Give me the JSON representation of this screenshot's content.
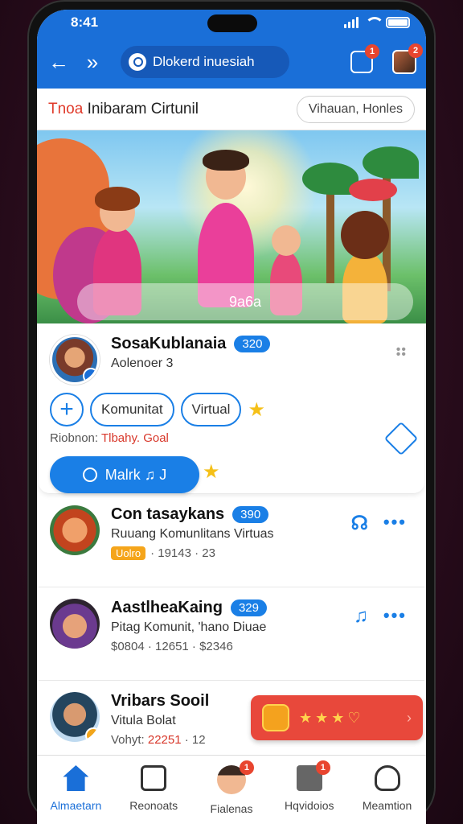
{
  "status": {
    "time": "8:41"
  },
  "nav": {
    "back_icon": "arrow-left-icon",
    "forward_icon": "chevron-right-icon",
    "search_placeholder": "Dlokerd inuesiah",
    "notify_badge": "1",
    "avatar_badge": "2"
  },
  "subheader": {
    "title_red": "Tnoa",
    "title_rest": " Inibaram Cirtunil",
    "pill": "Vihauan, Honles"
  },
  "hero": {
    "caption": "9a6a"
  },
  "featured": {
    "name": "SosaKublanaia",
    "count": "320",
    "meta": "Aolenoer 3",
    "chips": [
      "Komunitat",
      "Virtual"
    ],
    "line_label": "Riobnon:",
    "line_value": "Tlbahy. Goal",
    "button": "Malrk ♫ J"
  },
  "list": [
    {
      "name": "Con tasaykans",
      "count": "390",
      "meta": "Ruuang Komunlitans Virtuas",
      "tag": "Uolro",
      "sub": "· 19143 · 23"
    },
    {
      "name": "AastlheaKaing",
      "count": "329",
      "meta": "Pitag Komunit, 'hano Diuae",
      "tag": "",
      "sub": "$0804 · 12651 · $2346"
    },
    {
      "name": "Vribars Sooil",
      "count": "",
      "meta": "Vitula Bolat",
      "tag": "",
      "sub_label": "Vohyt:",
      "sub_red": "22251",
      "sub_rest": "· 12"
    }
  ],
  "tabs": [
    {
      "label": "Almaetarn",
      "icon": "home-icon"
    },
    {
      "label": "Reonoats",
      "icon": "square-icon"
    },
    {
      "label": "Fialenas",
      "icon": "face-icon",
      "badge": "1"
    },
    {
      "label": "Hqvidoios",
      "icon": "box-icon",
      "badge": "1"
    },
    {
      "label": "Meamtion",
      "icon": "person-icon"
    }
  ],
  "colors": {
    "brand": "#1a6fd8",
    "accent_red": "#e03a2a",
    "gold": "#f5a51b"
  }
}
